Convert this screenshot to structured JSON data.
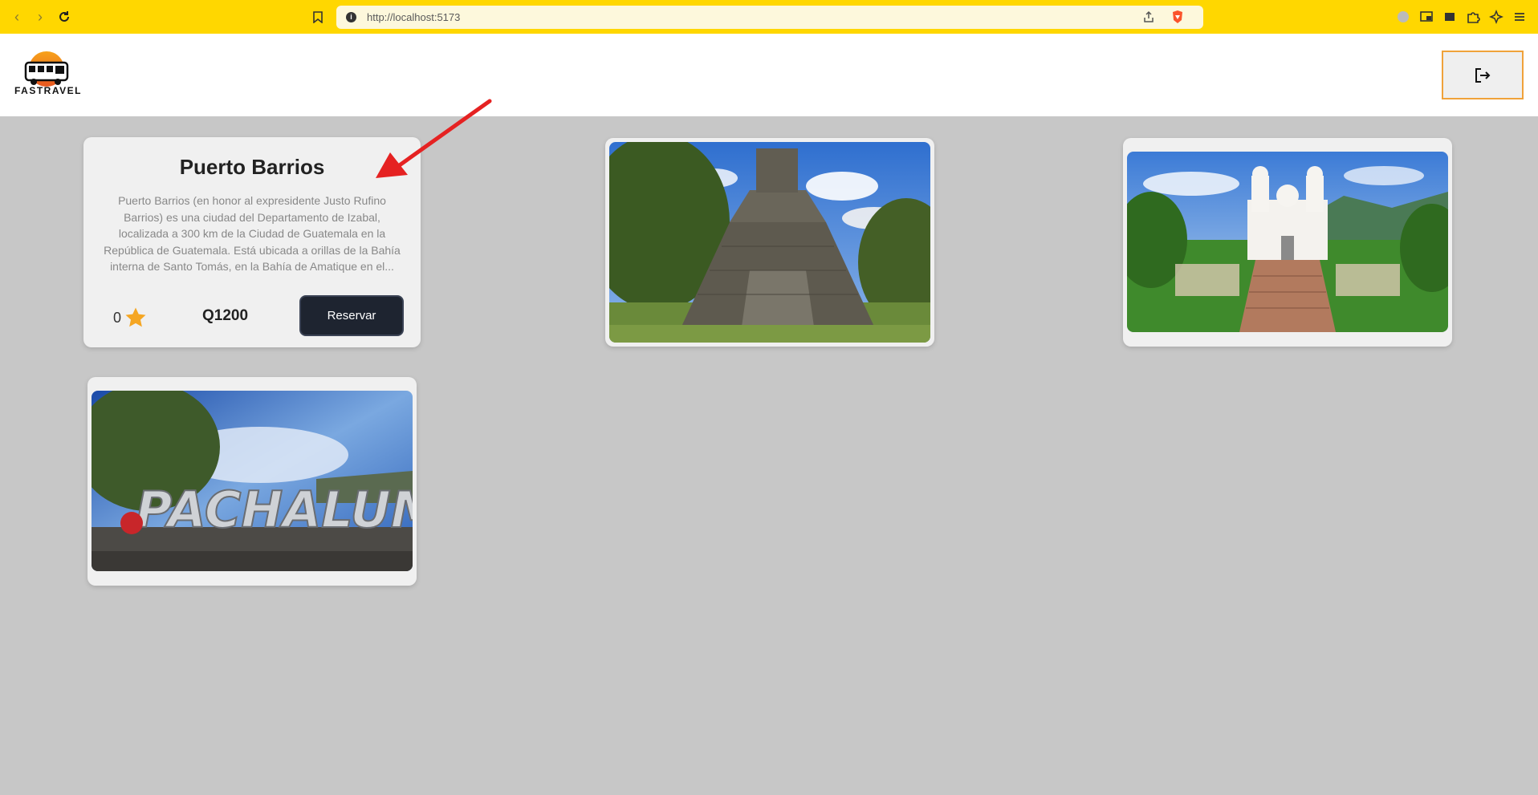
{
  "browser": {
    "url": "http://localhost:5173"
  },
  "header": {
    "logo_text": "FASTRAVEL",
    "logout_icon": "logout-icon"
  },
  "cards": [
    {
      "title": "Puerto Barrios",
      "description": "Puerto Barrios (en honor al expresidente Justo Rufino Barrios) es una ciudad del Departamento de Izabal, localizada a 300 km de la Ciudad de Guatemala en la República de Guatemala. Está ubicada a orillas de la Bahía interna de Santo Tomás, en la Bahía de Amatique en el...",
      "rating": "0",
      "price": "Q1200",
      "button_label": "Reservar"
    },
    {
      "image": "tikal-pyramid"
    },
    {
      "image": "esquipulas-basilica"
    },
    {
      "image": "pachalum-sign",
      "sign_text": "PACHALUM"
    }
  ],
  "colors": {
    "browser_bar": "#ffd700",
    "page_bg": "#c7c7c7",
    "button_dark": "#1e2430",
    "logout_border": "#f0a23a",
    "star": "#f5a623",
    "annotation_arrow": "#e52222"
  }
}
